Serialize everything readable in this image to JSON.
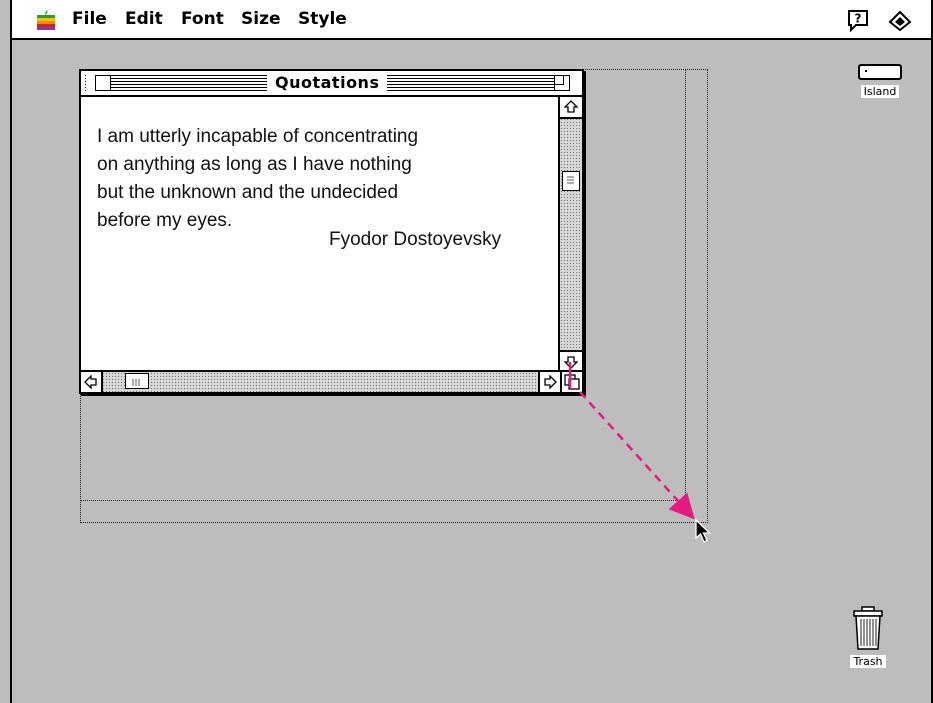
{
  "menubar": {
    "items": [
      {
        "label": "File"
      },
      {
        "label": "Edit"
      },
      {
        "label": "Font"
      },
      {
        "label": "Size"
      },
      {
        "label": "Style"
      }
    ],
    "apple_icon": "apple-rainbow-icon",
    "help_icon": "help-balloon-icon",
    "app_icon": "application-menu-icon"
  },
  "window": {
    "title": "Quotations",
    "quote": {
      "lines": [
        "I am utterly incapable of concentrating",
        "on anything as long as I have nothing",
        "but the unknown and the undecided",
        "before my eyes."
      ],
      "author": "Fyodor Dostoyevsky"
    }
  },
  "desktop": {
    "icons": [
      {
        "label": "Island",
        "icon": "hard-disk-icon"
      },
      {
        "label": "Trash",
        "icon": "trash-can-icon"
      }
    ]
  },
  "annotation": {
    "arrow_color": "#e8197c",
    "description_icon": "drag-resize-arrow"
  },
  "colors": {
    "desktop": "#bdbdbd",
    "accent_arrow": "#e8197c"
  }
}
